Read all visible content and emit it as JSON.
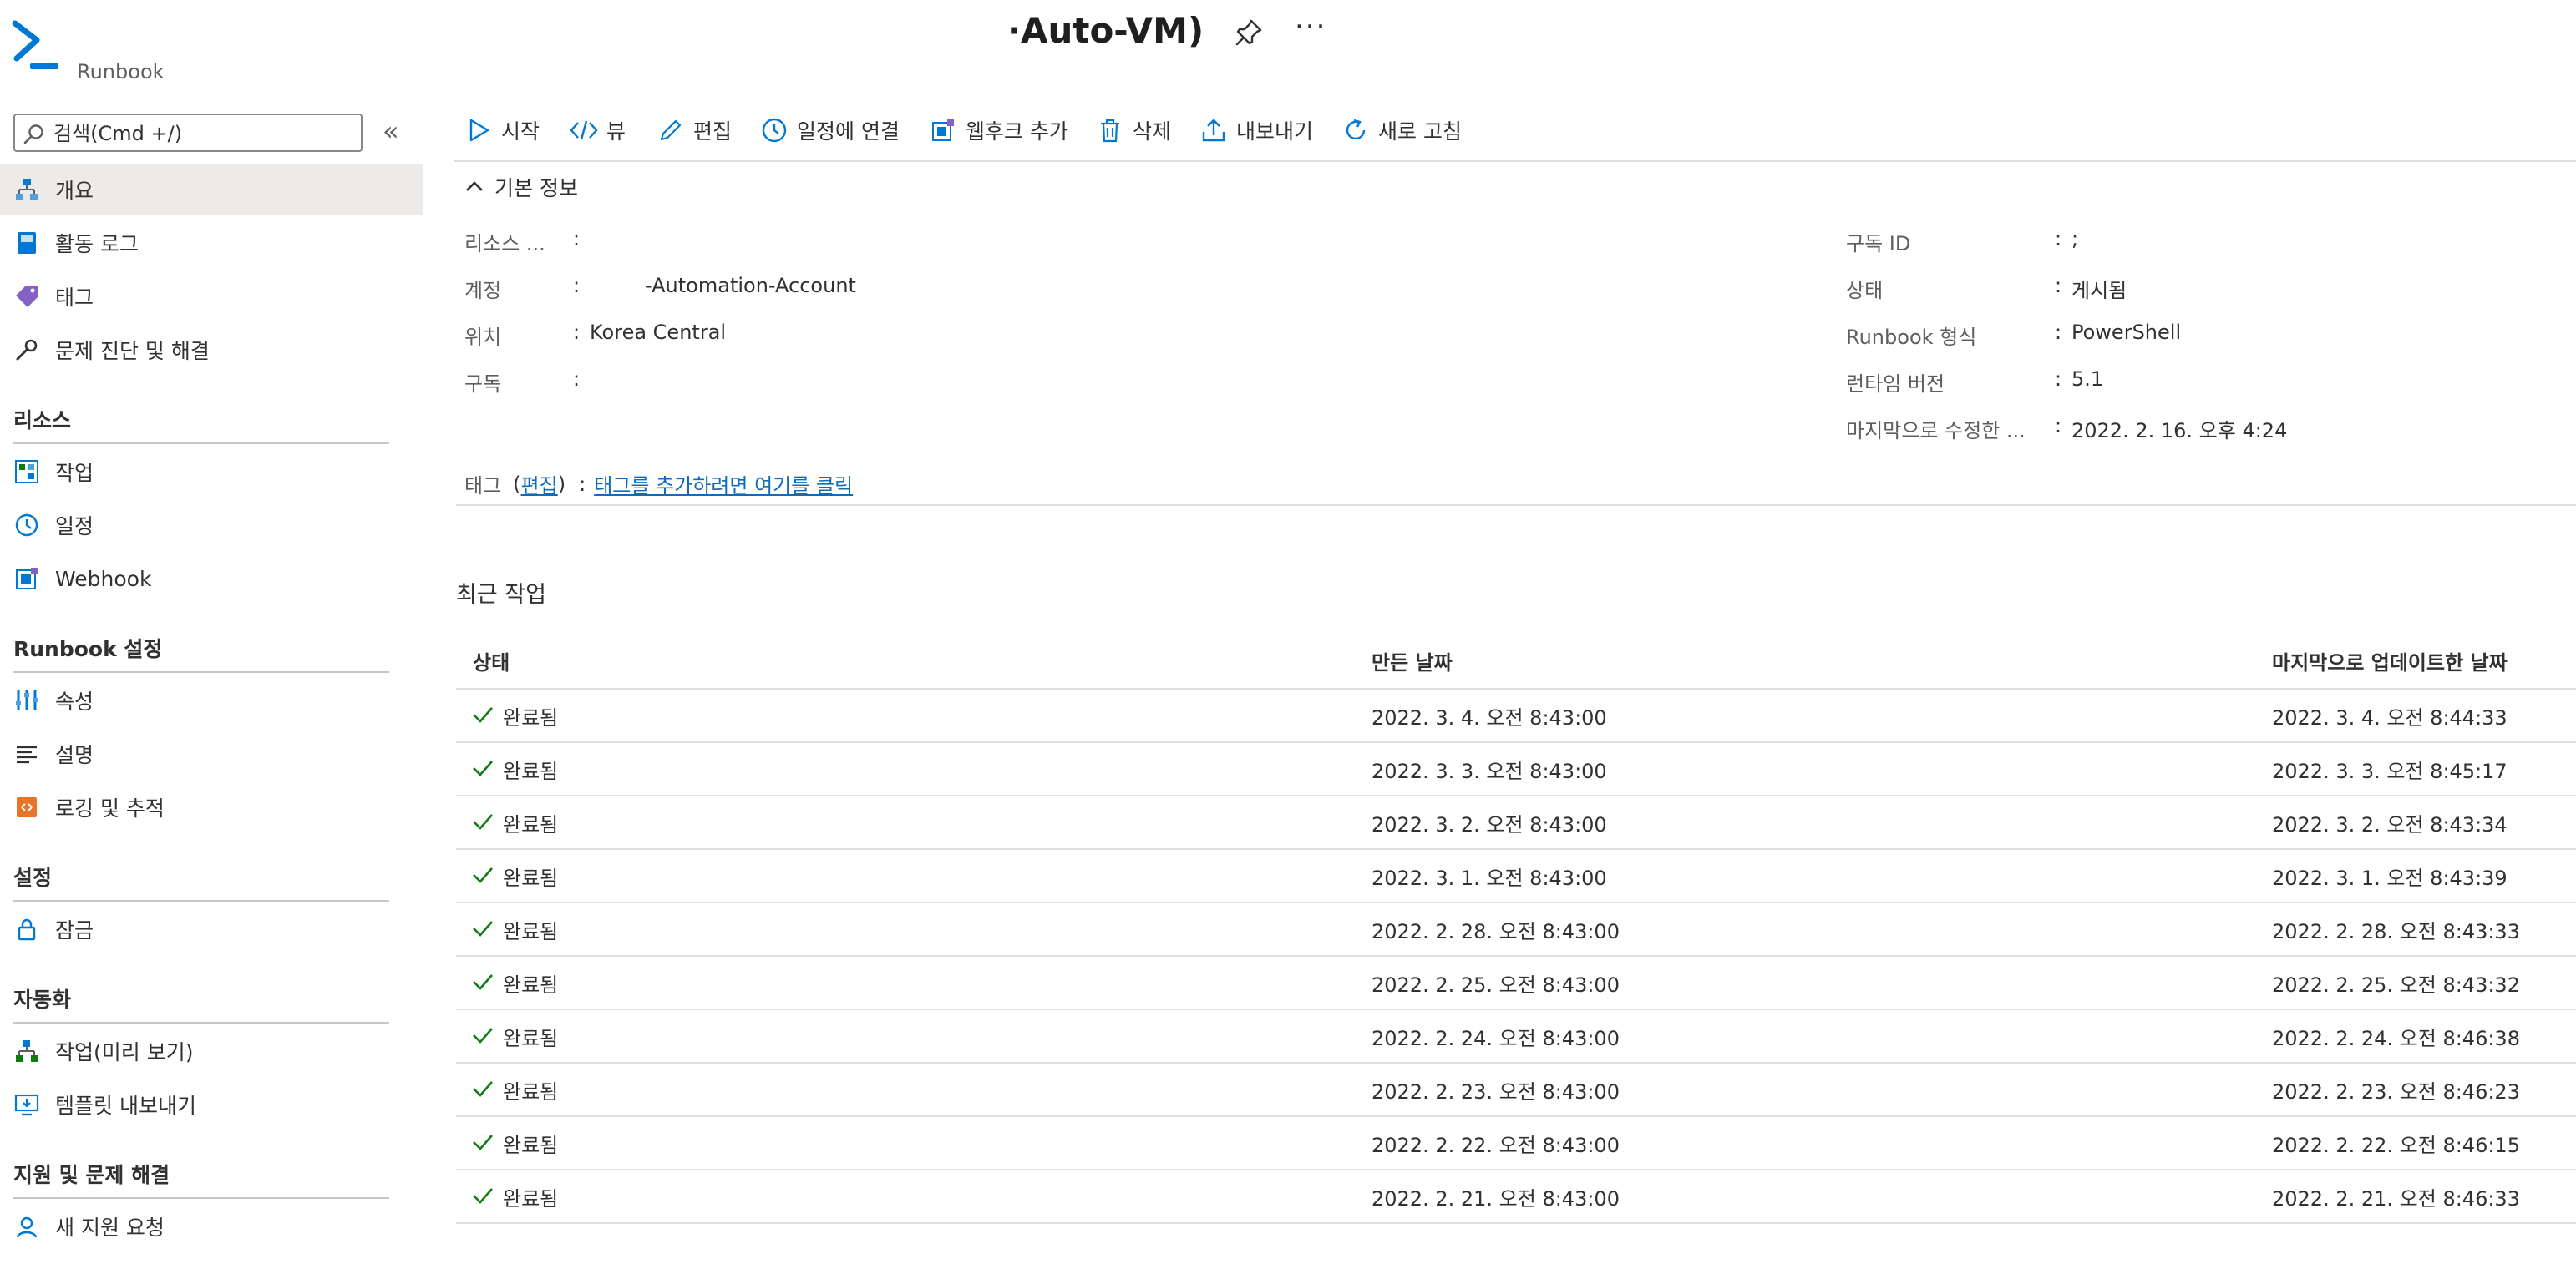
{
  "header": {
    "title": "·Auto-VM)",
    "subtitle": "Runbook",
    "more_label": "···"
  },
  "search": {
    "placeholder": "검색(Cmd +/)"
  },
  "sidebar": {
    "collapse_label": "«",
    "top_items": [
      {
        "label": "개요",
        "icon": "overview-icon",
        "selected": true
      },
      {
        "label": "활동 로그",
        "icon": "activity-log-icon"
      },
      {
        "label": "태그",
        "icon": "tag-icon"
      },
      {
        "label": "문제 진단 및 해결",
        "icon": "wrench-icon"
      }
    ],
    "sections": [
      {
        "title": "리소스",
        "items": [
          {
            "label": "작업",
            "icon": "jobs-icon"
          },
          {
            "label": "일정",
            "icon": "clock-icon"
          },
          {
            "label": "Webhook",
            "icon": "webhook-icon"
          }
        ]
      },
      {
        "title": "Runbook 설정",
        "items": [
          {
            "label": "속성",
            "icon": "properties-icon"
          },
          {
            "label": "설명",
            "icon": "description-icon"
          },
          {
            "label": "로깅 및 추적",
            "icon": "logging-icon"
          }
        ]
      },
      {
        "title": "설정",
        "items": [
          {
            "label": "잠금",
            "icon": "lock-icon"
          }
        ]
      },
      {
        "title": "자동화",
        "items": [
          {
            "label": "작업(미리 보기)",
            "icon": "tasks-preview-icon"
          },
          {
            "label": "템플릿 내보내기",
            "icon": "export-template-icon"
          }
        ]
      },
      {
        "title": "지원 및 문제 해결",
        "items": [
          {
            "label": "새 지원 요청",
            "icon": "support-icon"
          }
        ]
      }
    ]
  },
  "toolbar": {
    "start": "시작",
    "view": "뷰",
    "edit": "편집",
    "link_schedule": "일정에 연결",
    "add_webhook": "웹후크 추가",
    "delete": "삭제",
    "export": "내보내기",
    "refresh": "새로 고침"
  },
  "essentials": {
    "header": "기본 정보",
    "left": [
      {
        "label": "리소스 ...",
        "value": ""
      },
      {
        "label": "계정",
        "value": "-Automation-Account"
      },
      {
        "label": "위치",
        "value": "Korea Central"
      },
      {
        "label": "구독",
        "value": ""
      }
    ],
    "right": [
      {
        "label": "구독 ID",
        "value": ";"
      },
      {
        "label": "상태",
        "value": "게시됨"
      },
      {
        "label": "Runbook 형식",
        "value": "PowerShell"
      },
      {
        "label": "런타임 버전",
        "value": "5.1"
      },
      {
        "label": "마지막으로 수정한 ...",
        "value": "2022. 2. 16. 오후 4:24"
      }
    ],
    "tags_label": "태그",
    "tags_edit": "편집",
    "tags_link": "태그를 추가하려면 여기를 클릭"
  },
  "recent_jobs": {
    "title": "최근 작업",
    "columns": [
      "상태",
      "만든 날짜",
      "마지막으로 업데이트한 날짜"
    ],
    "rows": [
      {
        "status": "완료됨",
        "created": "2022. 3. 4. 오전 8:43:00",
        "updated": "2022. 3. 4. 오전 8:44:33"
      },
      {
        "status": "완료됨",
        "created": "2022. 3. 3. 오전 8:43:00",
        "updated": "2022. 3. 3. 오전 8:45:17"
      },
      {
        "status": "완료됨",
        "created": "2022. 3. 2. 오전 8:43:00",
        "updated": "2022. 3. 2. 오전 8:43:34"
      },
      {
        "status": "완료됨",
        "created": "2022. 3. 1. 오전 8:43:00",
        "updated": "2022. 3. 1. 오전 8:43:39"
      },
      {
        "status": "완료됨",
        "created": "2022. 2. 28. 오전 8:43:00",
        "updated": "2022. 2. 28. 오전 8:43:33"
      },
      {
        "status": "완료됨",
        "created": "2022. 2. 25. 오전 8:43:00",
        "updated": "2022. 2. 25. 오전 8:43:32"
      },
      {
        "status": "완료됨",
        "created": "2022. 2. 24. 오전 8:43:00",
        "updated": "2022. 2. 24. 오전 8:46:38"
      },
      {
        "status": "완료됨",
        "created": "2022. 2. 23. 오전 8:43:00",
        "updated": "2022. 2. 23. 오전 8:46:23"
      },
      {
        "status": "완료됨",
        "created": "2022. 2. 22. 오전 8:43:00",
        "updated": "2022. 2. 22. 오전 8:46:15"
      },
      {
        "status": "완료됨",
        "created": "2022. 2. 21. 오전 8:43:00",
        "updated": "2022. 2. 21. 오전 8:46:33"
      }
    ]
  },
  "colors": {
    "accent": "#0078d4",
    "link": "#0f6cbd",
    "success": "#107c10",
    "selected_bg": "#edebe9",
    "divider": "#e1dfdd"
  }
}
